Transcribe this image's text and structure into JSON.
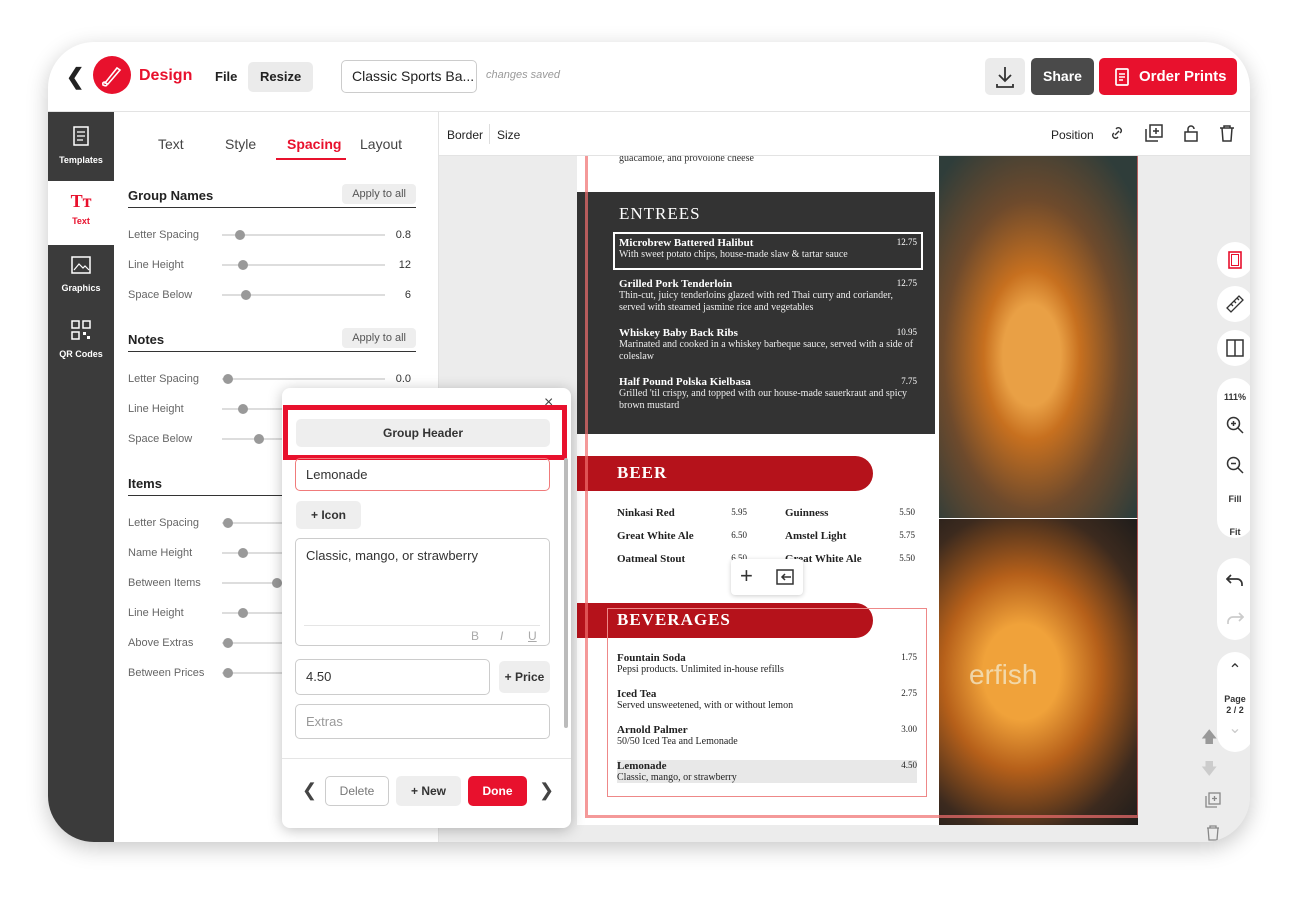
{
  "topbar": {
    "brand": "Design",
    "file": "File",
    "resize": "Resize",
    "doc_name": "Classic Sports Ba...",
    "saved": "changes saved",
    "share": "Share",
    "order": "Order Prints"
  },
  "nav": [
    {
      "label": "Templates"
    },
    {
      "label": "Text"
    },
    {
      "label": "Graphics"
    },
    {
      "label": "QR Codes"
    }
  ],
  "tabs": [
    "Text",
    "Style",
    "Spacing",
    "Layout"
  ],
  "sections": {
    "group_names": {
      "title": "Group Names",
      "apply": "Apply to all",
      "rows": [
        {
          "label": "Letter Spacing",
          "value": "0.8"
        },
        {
          "label": "Line Height",
          "value": "12"
        },
        {
          "label": "Space Below",
          "value": "6"
        }
      ]
    },
    "notes": {
      "title": "Notes",
      "apply": "Apply to all",
      "rows": [
        {
          "label": "Letter Spacing",
          "value": "0.0"
        },
        {
          "label": "Line Height",
          "value": ""
        },
        {
          "label": "Space Below",
          "value": ""
        }
      ]
    },
    "items": {
      "title": "Items",
      "rows": [
        {
          "label": "Letter Spacing"
        },
        {
          "label": "Name Height"
        },
        {
          "label": "Between Items"
        },
        {
          "label": "Line Height"
        },
        {
          "label": "Above Extras"
        },
        {
          "label": "Between Prices"
        }
      ]
    }
  },
  "toolbar": {
    "border": "Border",
    "size": "Size",
    "position": "Position"
  },
  "menu": {
    "top_note": "guacamole, and provolone cheese",
    "entrees_title": "ENTREES",
    "entrees": [
      {
        "name": "Microbrew Battered Halibut",
        "price": "12.75",
        "desc": "With sweet potato chips, house-made slaw & tartar sauce"
      },
      {
        "name": "Grilled Pork Tenderloin",
        "price": "12.75",
        "desc": "Thin-cut, juicy tenderloins glazed with red Thai curry and coriander, served with steamed jasmine rice and vegetables"
      },
      {
        "name": "Whiskey Baby Back Ribs",
        "price": "10.95",
        "desc": "Marinated and cooked in a whiskey barbeque sauce, served with a side of coleslaw"
      },
      {
        "name": "Half Pound Polska Kielbasa",
        "price": "7.75",
        "desc": "Grilled 'til crispy, and topped with our house-made sauerkraut and spicy brown mustard"
      }
    ],
    "beer_title": "BEER",
    "beer": [
      {
        "name": "Ninkasi Red",
        "price": "5.95"
      },
      {
        "name": "Guinness",
        "price": "5.50"
      },
      {
        "name": "Great White Ale",
        "price": "6.50"
      },
      {
        "name": "Amstel Light",
        "price": "5.75"
      },
      {
        "name": "Oatmeal Stout",
        "price": "6.50"
      },
      {
        "name": "Great White Ale",
        "price": "5.50"
      }
    ],
    "bev_title": "BEVERAGES",
    "beverages": [
      {
        "name": "Fountain Soda",
        "price": "1.75",
        "desc": "Pepsi products. Unlimited in-house refills"
      },
      {
        "name": "Iced Tea",
        "price": "2.75",
        "desc": "Served unsweetened, with or without lemon"
      },
      {
        "name": "Arnold Palmer",
        "price": "3.00",
        "desc": "50/50 Iced Tea and Lemonade"
      },
      {
        "name": "Lemonade",
        "price": "4.50",
        "desc": "Classic, mango, or strawberry"
      }
    ],
    "beer_sign": "erfish"
  },
  "right_tools": {
    "zoom": "111%",
    "fill": "Fill",
    "fit": "Fit",
    "page_label": "Page",
    "page": "2 / 2"
  },
  "popup": {
    "group_header": "Group Header",
    "name": "Lemonade",
    "icon": "+ Icon",
    "desc": "Classic, mango, or strawberry",
    "price": "4.50",
    "add_price": "+ Price",
    "extras_placeholder": "Extras",
    "delete": "Delete",
    "new": "+ New",
    "done": "Done"
  }
}
